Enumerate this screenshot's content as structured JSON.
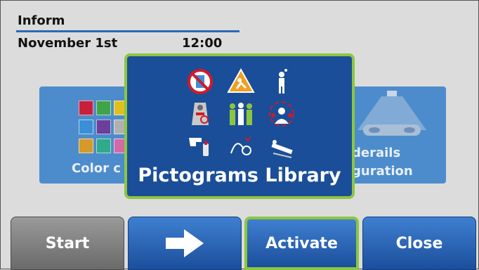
{
  "header": {
    "title": "Inform",
    "date": "November 1st",
    "time": "12:00"
  },
  "tiles": {
    "left": {
      "label": "Color c"
    },
    "right": {
      "label_line1": "derails",
      "label_line2": "guration"
    }
  },
  "swatch_colors": [
    "#c8203a",
    "#3fa34a",
    "#e0c020",
    "#3b8fd6",
    "#6b3f9a",
    "#b0b0b0",
    "#d49a2a",
    "#2faa8a",
    "#d26aa8"
  ],
  "popup": {
    "title": "Pictograms Library",
    "icons": [
      "no-drink-icon",
      "fall-risk-icon",
      "person-thinking-icon",
      "bed-restraint-icon",
      "group-assist-icon",
      "pain-person-icon",
      "hand-finger-icon",
      "iv-drip-icon",
      "stretcher-icon"
    ]
  },
  "buttons": {
    "start": "Start",
    "activate": "Activate",
    "close": "Close",
    "next_icon": "arrow-right-icon"
  },
  "colors": {
    "accent_blue": "#1a4e98",
    "highlight_green": "#8cc63f",
    "tile_blue": "#4d8ccc"
  }
}
